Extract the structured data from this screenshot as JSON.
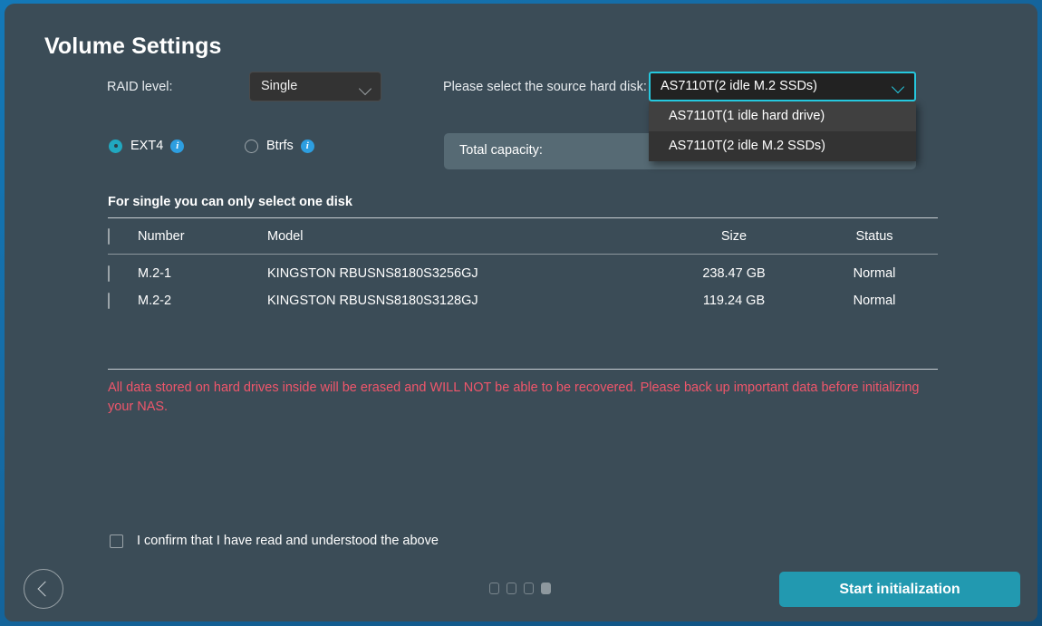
{
  "window": {
    "accent_border_color": "#1479b8",
    "panel_color": "#3b4c57"
  },
  "page_title": "Volume Settings",
  "raid": {
    "label": "RAID level:",
    "selected": "Single",
    "chevron_icon": "chevron-down-icon"
  },
  "source_disk": {
    "label": "Please select the source hard disk:",
    "selected": "AS7110T(2 idle M.2 SSDs)",
    "expanded": true,
    "focus_color": "#25c8de",
    "options": [
      {
        "label": "AS7110T(1 idle hard drive)",
        "hovered": true
      },
      {
        "label": "AS7110T(2 idle M.2 SSDs)",
        "hovered": false
      }
    ]
  },
  "capacity": {
    "label": "Total capacity:",
    "value": ""
  },
  "filesystem": {
    "options": [
      {
        "label": "EXT4",
        "selected": true,
        "info_icon": "info-icon"
      },
      {
        "label": "Btrfs",
        "selected": false,
        "info_icon": "info-icon"
      }
    ],
    "selected_color": "#21a8c0",
    "info_color": "#2d9ee0"
  },
  "disk_table": {
    "caption": "For single you can only select one disk",
    "columns": [
      "Number",
      "Model",
      "Size",
      "Status"
    ],
    "header_checkbox_checked": false,
    "rows": [
      {
        "checked": false,
        "number": "M.2-1",
        "model": "KINGSTON RBUSNS8180S3256GJ",
        "size": "238.47 GB",
        "status": "Normal"
      },
      {
        "checked": false,
        "number": "M.2-2",
        "model": "KINGSTON RBUSNS8180S3128GJ",
        "size": "119.24 GB",
        "status": "Normal"
      }
    ]
  },
  "warning": {
    "text": "All data stored on hard drives inside will be erased and WILL NOT be able to be recovered. Please back up important data before initializing your NAS.",
    "color": "#f0566b"
  },
  "confirm": {
    "label": "I confirm that I have read and understood the above",
    "checked": false
  },
  "footer": {
    "back_icon": "chevron-left-icon",
    "pager": {
      "total": 4,
      "active_index": 3
    },
    "start_label": "Start initialization",
    "start_color": "#2299b0"
  }
}
